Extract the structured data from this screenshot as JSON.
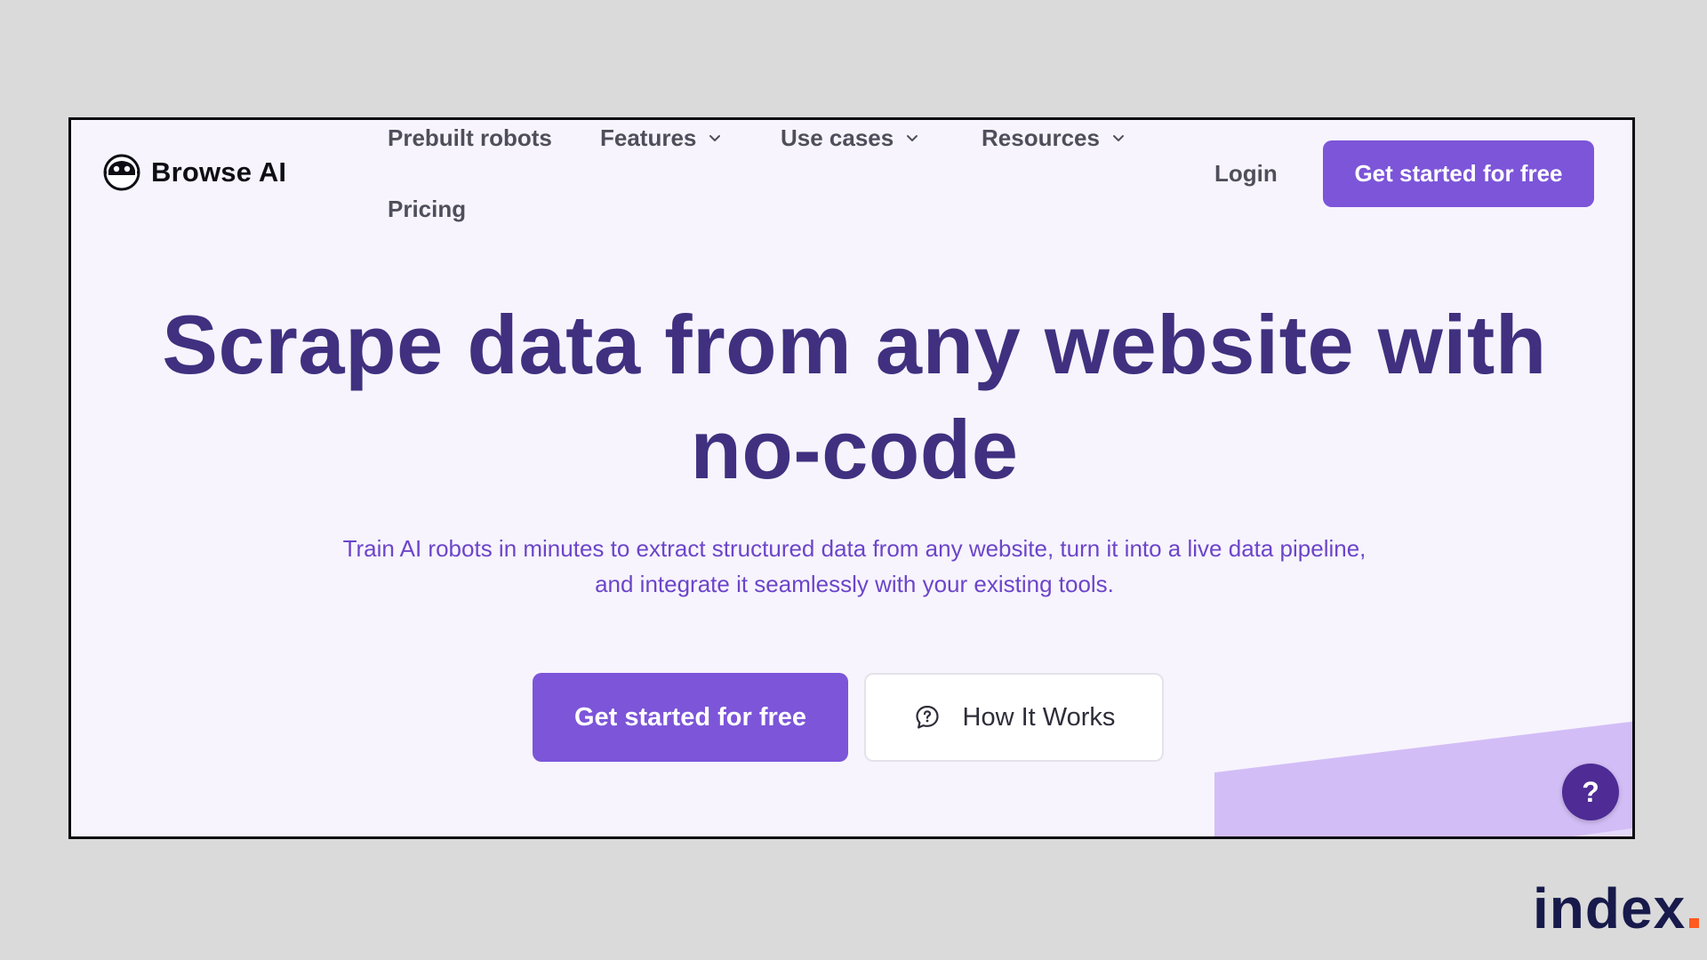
{
  "header": {
    "logo": {
      "text": "Browse AI",
      "icon": "robot-face-icon"
    },
    "nav": {
      "prebuilt_robots": "Prebuilt robots",
      "features": "Features",
      "use_cases": "Use cases",
      "resources": "Resources",
      "pricing": "Pricing"
    },
    "login": "Login",
    "cta": "Get started for free"
  },
  "hero": {
    "title_line1": "Scrape data from any website with",
    "title_line2": "no-code",
    "subtitle_line1": "Train AI robots in minutes to extract structured data from any website, turn it into a live data pipeline,",
    "subtitle_line2": "and integrate it seamlessly with your existing tools.",
    "primary_cta": "Get started for free",
    "secondary_cta": "How It Works",
    "secondary_cta_icon": "chat-question-icon"
  },
  "help_button": {
    "label": "?"
  },
  "watermark": {
    "text": "index"
  },
  "colors": {
    "accent": "#7c55d9",
    "title": "#40307f",
    "subtitle": "#6c45c9",
    "page_background": "#f7f4fd",
    "outer_background": "#dadada",
    "decoration": "#d3bdf6",
    "help_button": "#4e2b95",
    "watermark": "#171a4a",
    "watermark_dot": "#ff5a1f"
  }
}
